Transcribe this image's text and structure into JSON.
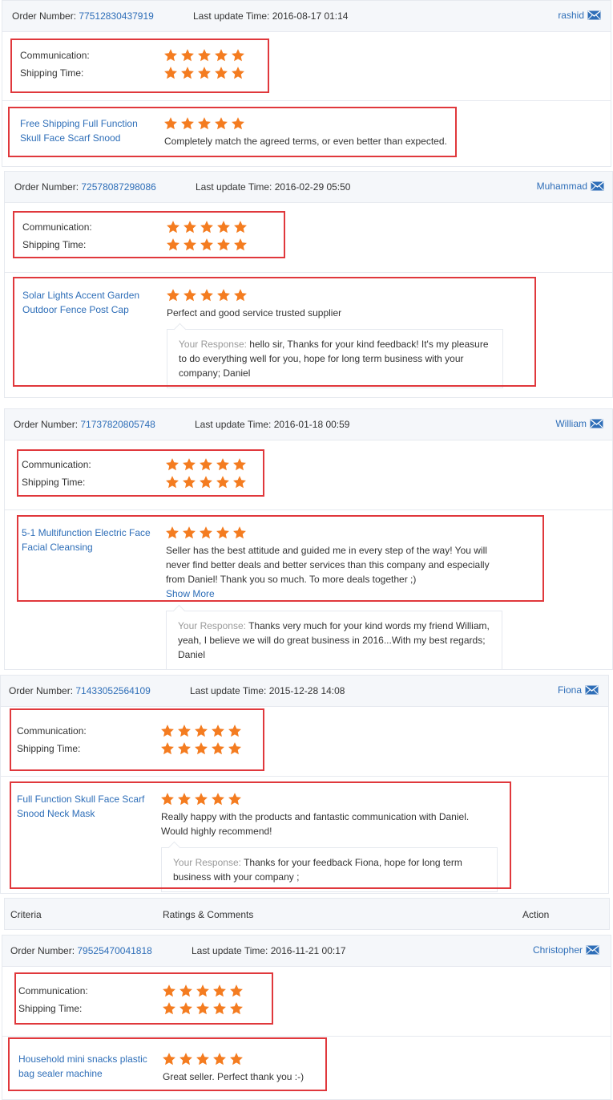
{
  "labels": {
    "order_number": "Order Number:",
    "last_update": "Last update Time:",
    "communication": "Communication:",
    "shipping_time": "Shipping Time:",
    "your_response": "Your Response:",
    "show_more": "Show More"
  },
  "icons": {
    "mail": "mail-icon",
    "star": "star-icon"
  },
  "colors": {
    "accent": "#2e6eb8",
    "star": "#f47c20",
    "highlight": "#e0383c",
    "header_bg": "#f5f7fa"
  },
  "column_headers": {
    "criteria": "Criteria",
    "ratings": "Ratings & Comments",
    "action": "Action"
  },
  "reviews": [
    {
      "order_number": "77512830437919",
      "update_time": "2016-08-17 01:14",
      "buyer": "rashid",
      "communication_rating": 5,
      "shipping_rating": 5,
      "product": "Free Shipping Full Function Skull Face Scarf Snood",
      "product_rating": 5,
      "comment": "Completely match the agreed terms, or even better than expected.",
      "response": ""
    },
    {
      "order_number": "72578087298086",
      "update_time": "2016-02-29 05:50",
      "buyer": "Muhammad",
      "communication_rating": 5,
      "shipping_rating": 5,
      "product": "Solar Lights Accent Garden Outdoor Fence Post Cap",
      "product_rating": 5,
      "comment": "Perfect and good service trusted supplier",
      "response": "hello sir, Thanks for your kind feedback! It's my pleasure to do everything well for you, hope for long term business with your company; Daniel"
    },
    {
      "order_number": "71737820805748",
      "update_time": "2016-01-18 00:59",
      "buyer": "William",
      "communication_rating": 5,
      "shipping_rating": 5,
      "product": "5-1 Multifunction Electric Face Facial Cleansing",
      "product_rating": 5,
      "comment": "Seller has the best attitude and guided me in every step of the way! You will never find better deals and better services than this company and especially from Daniel! Thank you so much. To more deals together ;)",
      "response": "Thanks very much for your kind words my friend William, yeah, I believe we will do great business in 2016...With my best regards; Daniel"
    },
    {
      "order_number": "71433052564109",
      "update_time": "2015-12-28 14:08",
      "buyer": "Fiona",
      "communication_rating": 5,
      "shipping_rating": 5,
      "product": "Full Function Skull Face Scarf Snood Neck Mask",
      "product_rating": 5,
      "comment": "Really happy with the products and fantastic communication with Daniel. Would highly recommend!",
      "response": "Thanks for your feedback Fiona, hope for long term business with your company ;"
    },
    {
      "order_number": "79525470041818",
      "update_time": "2016-11-21 00:17",
      "buyer": "Christopher",
      "communication_rating": 5,
      "shipping_rating": 5,
      "product": "Household mini snacks plastic bag sealer machine",
      "product_rating": 5,
      "comment": "Great seller. Perfect thank you :-)",
      "response": ""
    }
  ]
}
